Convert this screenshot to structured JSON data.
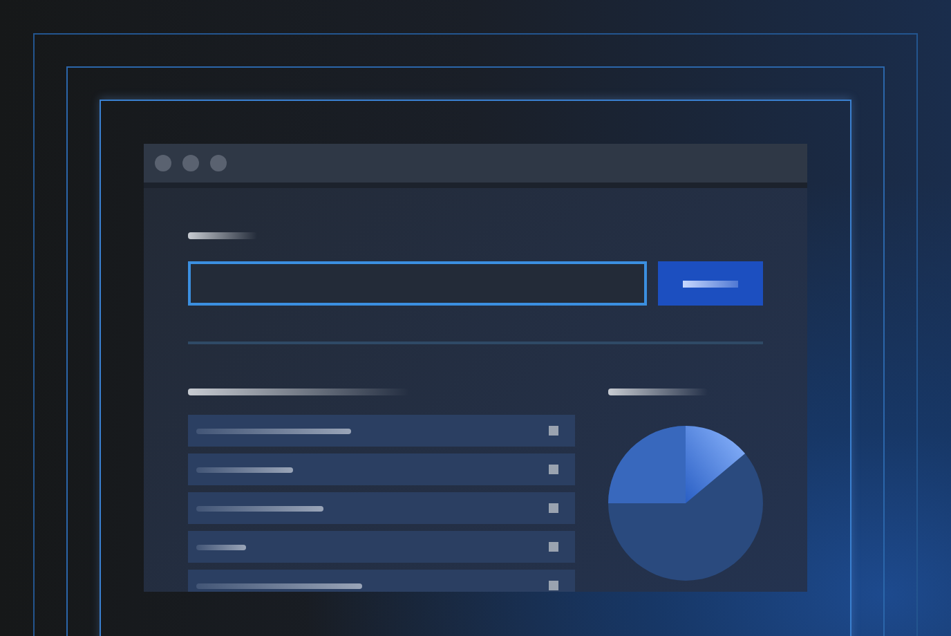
{
  "window_controls": [
    {
      "kind": "dot"
    },
    {
      "kind": "dot"
    },
    {
      "kind": "dot"
    }
  ],
  "list_rows": [
    {
      "kind": "long"
    },
    {
      "kind": "short"
    },
    {
      "kind": "medium"
    },
    {
      "kind": "tiny"
    },
    {
      "kind": "wide"
    }
  ]
}
